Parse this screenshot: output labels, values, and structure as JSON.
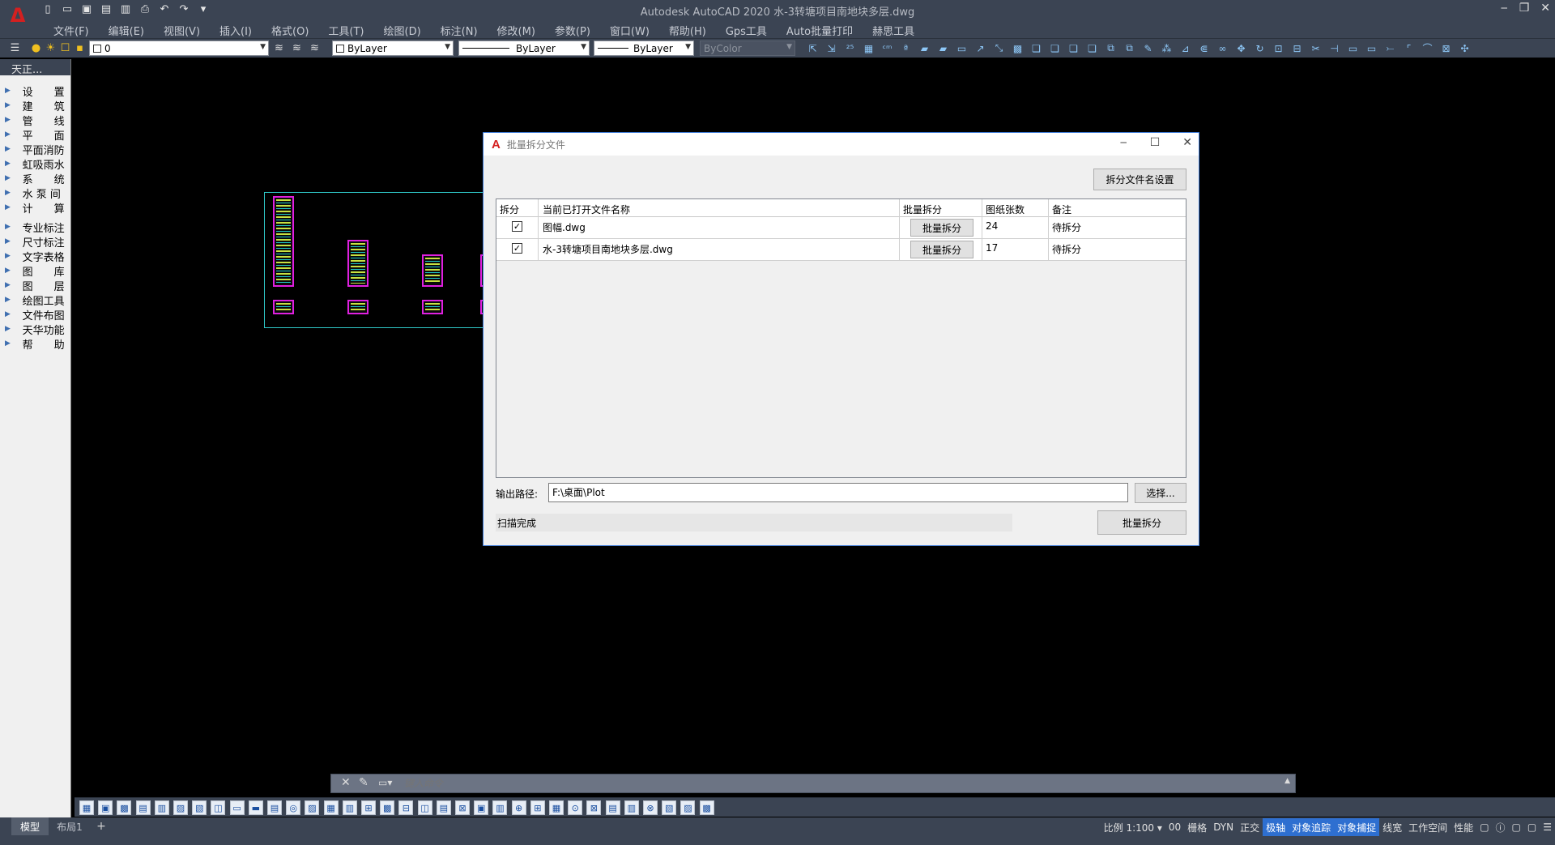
{
  "window": {
    "title": "Autodesk AutoCAD 2020    水-3转塘项目南地块多层.dwg",
    "min_icon": "minimize-icon",
    "max_icon": "restore-icon",
    "close_icon": "close-icon"
  },
  "menu": [
    "文件(F)",
    "编辑(E)",
    "视图(V)",
    "插入(I)",
    "格式(O)",
    "工具(T)",
    "绘图(D)",
    "标注(N)",
    "修改(M)",
    "参数(P)",
    "窗口(W)",
    "帮助(H)",
    "Gps工具",
    "Auto批量打印",
    "赫思工具"
  ],
  "properties": {
    "layer": "0",
    "color": "ByLayer",
    "linetype": "ByLayer",
    "lineweight": "ByLayer",
    "plotstyle": "ByColor"
  },
  "left_panel": {
    "header": "天正...",
    "group1": [
      "设　　置",
      "建　　筑",
      "管　　线",
      "平　　面",
      "平面消防",
      "虹吸雨水",
      "系　　统",
      "水 泵 间",
      "计　　算"
    ],
    "group2": [
      "专业标注",
      "尺寸标注",
      "文字表格",
      "图　　库",
      "图　　层",
      "绘图工具",
      "文件布图",
      "天华功能",
      "帮　　助"
    ]
  },
  "dialog": {
    "title": "批量拆分文件",
    "settings_button": "拆分文件名设置",
    "columns": [
      "拆分",
      "当前已打开文件名称",
      "批量拆分",
      "图纸张数",
      "备注"
    ],
    "rows": [
      {
        "checked": true,
        "name": "图幅.dwg",
        "action": "批量拆分",
        "count": "24",
        "note": "待拆分"
      },
      {
        "checked": true,
        "name": "水-3转塘项目南地块多层.dwg",
        "action": "批量拆分",
        "count": "17",
        "note": "待拆分"
      }
    ],
    "output_label": "输出路径:",
    "output_path": "F:\\桌面\\Plot",
    "browse_button": "选择...",
    "status": "扫描完成",
    "run_button": "批量拆分"
  },
  "command": {
    "placeholder": "键入命令"
  },
  "status_bar": {
    "tab_model": "模型",
    "tab_layout": "布局1",
    "add_tab": "+",
    "scale": "比例 1:100",
    "items": [
      "00",
      "栅格",
      "DYN",
      "正交",
      "极轴",
      "对象追踪",
      "对象捕捉",
      "线宽",
      "工作空间",
      "性能"
    ],
    "active": [
      "极轴",
      "对象追踪",
      "对象捕捉"
    ]
  },
  "colors": {
    "chrome": "#3b4453",
    "accent": "#2e6fd0",
    "viewport_frame": "#2fc8c8",
    "sheet_frame": "#e020e0"
  }
}
